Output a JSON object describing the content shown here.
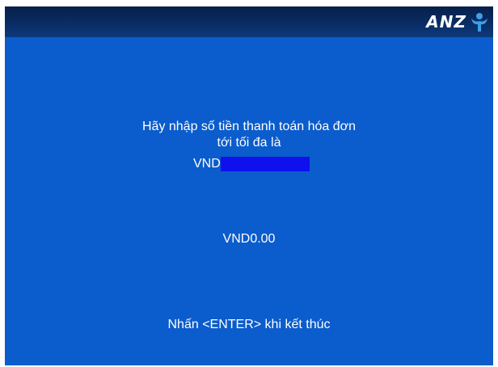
{
  "header": {
    "logo_text": "ANZ",
    "logo_icon": "anz-person-icon"
  },
  "prompt": {
    "line1": "Hãy nhập số tiền thanh toán hóa đơn",
    "line2": "tới tối đa là",
    "currency_label": "VND",
    "max_amount": ""
  },
  "entry": {
    "amount": "VND0.00"
  },
  "footer": {
    "instruction": "Nhấn <ENTER> khi kết thúc"
  },
  "colors": {
    "screen_background": "#0b5ccc",
    "header_bar": "#0a2e66",
    "highlight": "#1010ee",
    "logo_icon": "#3aa0e8"
  }
}
